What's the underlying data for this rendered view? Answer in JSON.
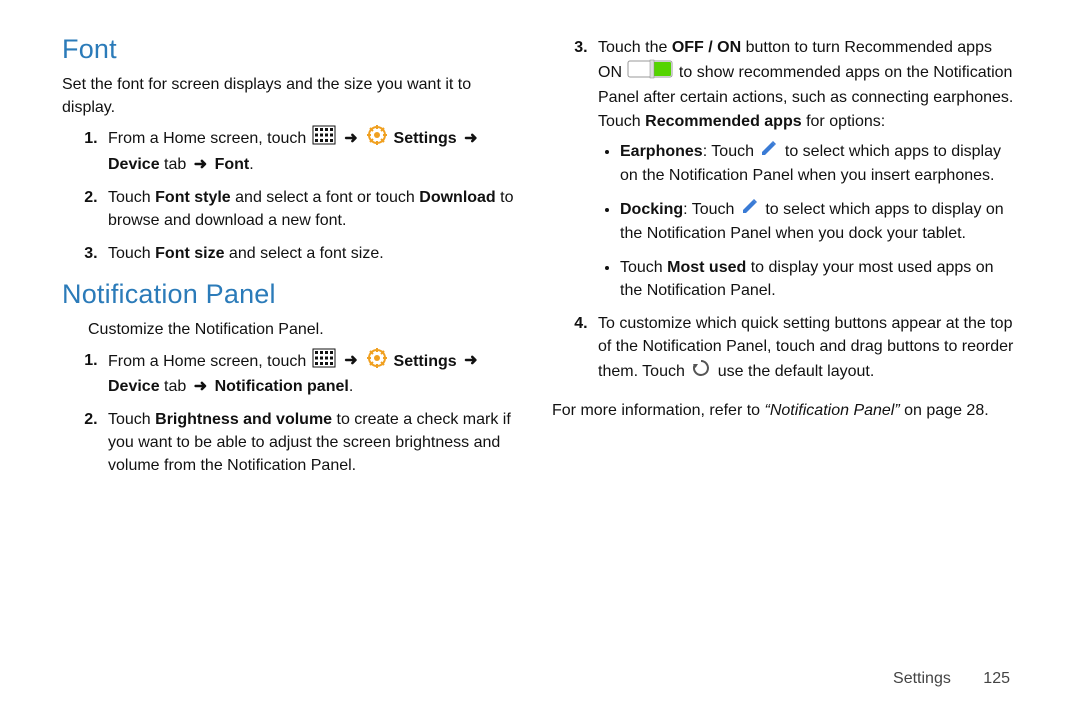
{
  "arrow": "➜",
  "left": {
    "font": {
      "heading": "Font",
      "intro": "Set the font for screen displays and the size you want it to display.",
      "step1_a": "From a Home screen, touch ",
      "step1_settings": "Settings",
      "step1_devicetab": "Device",
      "step1_tabword": " tab ",
      "step1_dest": "Font",
      "step2_a": "Touch ",
      "step2_b": "Font style",
      "step2_c": " and select a font or touch ",
      "step2_d": "Download",
      "step2_e": " to browse and download a new font.",
      "step3_a": "Touch ",
      "step3_b": "Font size",
      "step3_c": " and select a font size."
    },
    "notif": {
      "heading": "Notification Panel",
      "intro": "Customize the Notification Panel.",
      "step1_a": "From a Home screen, touch ",
      "step1_settings": "Settings",
      "step1_devicetab": "Device",
      "step1_tabword": " tab ",
      "step1_dest": "Notification panel",
      "step2_a": "Touch ",
      "step2_b": "Brightness and volume",
      "step2_c": " to create a check mark if you want to be able to adjust the screen brightness and volume from the Notification Panel."
    }
  },
  "right": {
    "step3_a": "Touch the ",
    "step3_b": "OFF / ON",
    "step3_c": " button to turn Recommended apps ON ",
    "step3_d": " to show recommended apps on the Notification Panel after certain actions, such as connecting earphones. Touch ",
    "step3_e": "Recommended apps",
    "step3_f": " for options:",
    "bul1_a": "Earphones",
    "bul1_b": ": Touch ",
    "bul1_c": " to select which apps to display on the Notification Panel when you insert earphones.",
    "bul2_a": "Docking",
    "bul2_b": ": Touch ",
    "bul2_c": " to select which apps to display on the Notification Panel when you dock your tablet.",
    "bul3_a": "Touch ",
    "bul3_b": "Most used",
    "bul3_c": " to display your most used apps on the Notification Panel.",
    "step4_a": "To customize which quick setting buttons appear at the top of the Notification Panel, touch and drag buttons to reorder them. Touch ",
    "step4_b": " use the default layout.",
    "more_a": "For more information, refer to ",
    "more_b": "“Notification Panel”",
    "more_c": " on page 28."
  },
  "footer": {
    "section": "Settings",
    "page": "125"
  }
}
